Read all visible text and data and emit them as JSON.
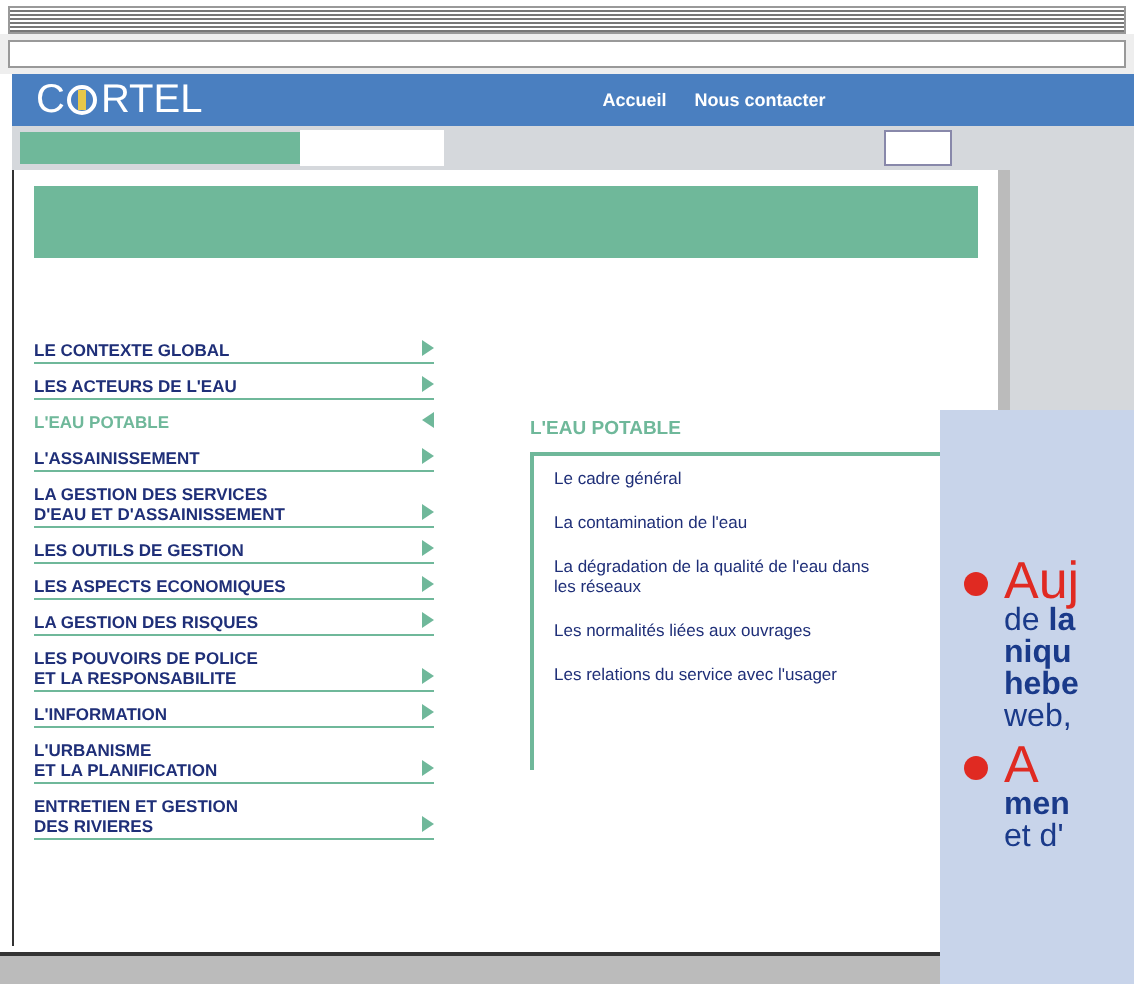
{
  "header": {
    "logo_left": "C",
    "logo_right": "RTEL",
    "nav": [
      "Accueil",
      "Nous contacter"
    ]
  },
  "menu": [
    {
      "label": "LE CONTEXTE GLOBAL",
      "selected": false
    },
    {
      "label": "LES ACTEURS  DE L'EAU",
      "selected": false
    },
    {
      "label": "L'EAU POTABLE",
      "selected": true
    },
    {
      "label": "L'ASSAINISSEMENT",
      "selected": false
    },
    {
      "label": "LA GESTION DES SERVICES\nD'EAU ET D'ASSAINISSEMENT",
      "selected": false
    },
    {
      "label": "LES OUTILS DE GESTION",
      "selected": false
    },
    {
      "label": "LES ASPECTS ECONOMIQUES",
      "selected": false
    },
    {
      "label": "LA GESTION DES RISQUES",
      "selected": false
    },
    {
      "label": "LES POUVOIRS DE POLICE\nET LA RESPONSABILITE",
      "selected": false
    },
    {
      "label": "L'INFORMATION",
      "selected": false
    },
    {
      "label": "L'URBANISME\nET LA PLANIFICATION",
      "selected": false
    },
    {
      "label": "ENTRETIEN ET GESTION\nDES RIVIERES",
      "selected": false
    }
  ],
  "submenu": {
    "title": "L'EAU POTABLE",
    "items": [
      "Le cadre général",
      "La contamination de l'eau",
      "La dégradation de la qualité de l'eau dans les réseaux",
      "Les normalités liées aux ouvrages",
      "Les relations du service avec l'usager"
    ]
  },
  "overlay": {
    "bullets": [
      {
        "lines": [
          "Auj",
          "de **la**",
          "**niqu**",
          "**hebe**",
          "web,"
        ]
      },
      {
        "lines": [
          "A",
          "**men**",
          "et d'"
        ]
      }
    ]
  }
}
